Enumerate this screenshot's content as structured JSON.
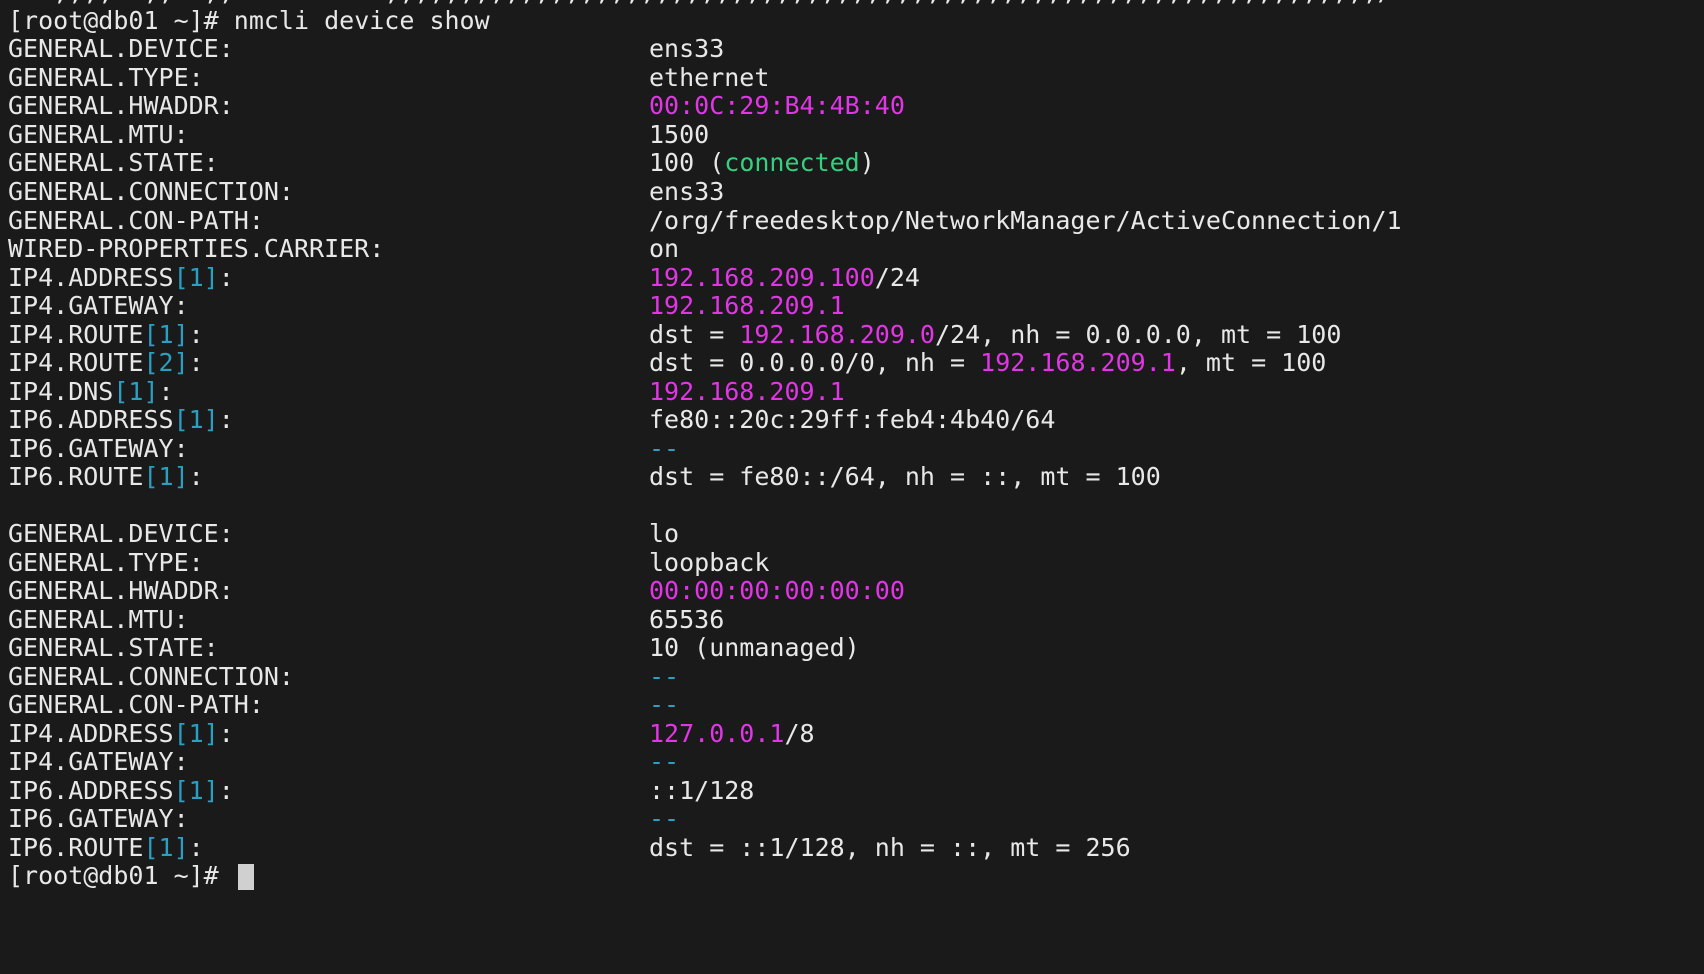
{
  "terminal": {
    "prompt": "[root@db01 ~]# ",
    "command": "nmcli device show",
    "top_clipped": "...,,,,..,,  ,,          ,,,,,,,,,,,,,,,,,,,,,,,,,,,,,,,,,,,,,,,,,,,,,,,,,,,,,,,,,,,,,,,,,,/",
    "device1": {
      "r0": {
        "label": "GENERAL.DEVICE:",
        "value": "ens33"
      },
      "r1": {
        "label": "GENERAL.TYPE:",
        "value": "ethernet"
      },
      "r2": {
        "label": "GENERAL.HWADDR:",
        "value": "00:0C:29:B4:4B:40"
      },
      "r3": {
        "label": "GENERAL.MTU:",
        "value": "1500"
      },
      "r4": {
        "label": "GENERAL.STATE:",
        "v1": "100 (",
        "v2": "connected",
        "v3": ")"
      },
      "r5": {
        "label": "GENERAL.CONNECTION:",
        "value": "ens33"
      },
      "r6": {
        "label": "GENERAL.CON-PATH:",
        "value": "/org/freedesktop/NetworkManager/ActiveConnection/1"
      },
      "r7": {
        "label": "WIRED-PROPERTIES.CARRIER:",
        "value": "on"
      },
      "r8": {
        "l1": "IP4.ADDRESS",
        "l2": "[1]",
        "l3": ":",
        "v1": "192.168.209.100",
        "v2": "/24"
      },
      "r9": {
        "label": "IP4.GATEWAY:",
        "value": "192.168.209.1"
      },
      "r10": {
        "l1": "IP4.ROUTE",
        "l2": "[1]",
        "l3": ":",
        "v1": "dst = ",
        "v2": "192.168.209.0",
        "v3": "/24, nh = 0.0.0.0, mt = 100"
      },
      "r11": {
        "l1": "IP4.ROUTE",
        "l2": "[2]",
        "l3": ":",
        "v1": "dst = 0.0.0.0/0, nh = ",
        "v2": "192.168.209.1",
        "v3": ", mt = 100"
      },
      "r12": {
        "l1": "IP4.DNS",
        "l2": "[1]",
        "l3": ":",
        "value": "192.168.209.1"
      },
      "r13": {
        "l1": "IP6.ADDRESS",
        "l2": "[1]",
        "l3": ":",
        "value": "fe80::20c:29ff:feb4:4b40/64"
      },
      "r14": {
        "label": "IP6.GATEWAY:",
        "value": "--"
      },
      "r15": {
        "l1": "IP6.ROUTE",
        "l2": "[1]",
        "l3": ":",
        "value": "dst = fe80::/64, nh = ::, mt = 100"
      }
    },
    "device2": {
      "r0": {
        "label": "GENERAL.DEVICE:",
        "value": "lo"
      },
      "r1": {
        "label": "GENERAL.TYPE:",
        "value": "loopback"
      },
      "r2": {
        "label": "GENERAL.HWADDR:",
        "value": "00:00:00:00:00:00"
      },
      "r3": {
        "label": "GENERAL.MTU:",
        "value": "65536"
      },
      "r4": {
        "label": "GENERAL.STATE:",
        "value": "10 (unmanaged)"
      },
      "r5": {
        "label": "GENERAL.CONNECTION:",
        "value": "--"
      },
      "r6": {
        "label": "GENERAL.CON-PATH:",
        "value": "--"
      },
      "r7": {
        "l1": "IP4.ADDRESS",
        "l2": "[1]",
        "l3": ":",
        "v1": "127.0.0.1",
        "v2": "/8"
      },
      "r8": {
        "label": "IP4.GATEWAY:",
        "value": "--"
      },
      "r9": {
        "l1": "IP6.ADDRESS",
        "l2": "[1]",
        "l3": ":",
        "value": "::1/128"
      },
      "r10": {
        "label": "IP6.GATEWAY:",
        "value": "--"
      },
      "r11": {
        "l1": "IP6.ROUTE",
        "l2": "[1]",
        "l3": ":",
        "value": "dst = ::1/128, nh = ::, mt = 256"
      }
    },
    "final_prompt": "[root@db01 ~]# "
  }
}
